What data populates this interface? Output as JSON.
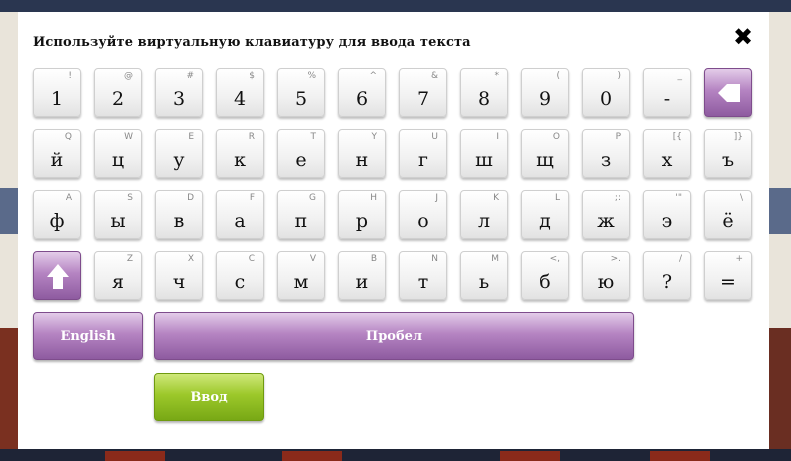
{
  "dialog": {
    "title": "Используйте виртуальную клавиатуру для ввода текста",
    "close_icon": "close-icon"
  },
  "keyboard": {
    "rows": [
      [
        {
          "primary": "1",
          "secondary": "!"
        },
        {
          "primary": "2",
          "secondary": "@"
        },
        {
          "primary": "3",
          "secondary": "#"
        },
        {
          "primary": "4",
          "secondary": "$"
        },
        {
          "primary": "5",
          "secondary": "%"
        },
        {
          "primary": "6",
          "secondary": "^"
        },
        {
          "primary": "7",
          "secondary": "&"
        },
        {
          "primary": "8",
          "secondary": "*"
        },
        {
          "primary": "9",
          "secondary": "("
        },
        {
          "primary": "0",
          "secondary": ")"
        },
        {
          "primary": "-",
          "secondary": "_"
        }
      ],
      [
        {
          "primary": "й",
          "secondary": "Q"
        },
        {
          "primary": "ц",
          "secondary": "W"
        },
        {
          "primary": "у",
          "secondary": "E"
        },
        {
          "primary": "к",
          "secondary": "R"
        },
        {
          "primary": "е",
          "secondary": "T"
        },
        {
          "primary": "н",
          "secondary": "Y"
        },
        {
          "primary": "г",
          "secondary": "U"
        },
        {
          "primary": "ш",
          "secondary": "I"
        },
        {
          "primary": "щ",
          "secondary": "O"
        },
        {
          "primary": "з",
          "secondary": "P"
        },
        {
          "primary": "х",
          "secondary": "[{"
        },
        {
          "primary": "ъ",
          "secondary": "]}"
        }
      ],
      [
        {
          "primary": "ф",
          "secondary": "A"
        },
        {
          "primary": "ы",
          "secondary": "S"
        },
        {
          "primary": "в",
          "secondary": "D"
        },
        {
          "primary": "а",
          "secondary": "F"
        },
        {
          "primary": "п",
          "secondary": "G"
        },
        {
          "primary": "р",
          "secondary": "H"
        },
        {
          "primary": "о",
          "secondary": "J"
        },
        {
          "primary": "л",
          "secondary": "K"
        },
        {
          "primary": "д",
          "secondary": "L"
        },
        {
          "primary": "ж",
          "secondary": ";:"
        },
        {
          "primary": "э",
          "secondary": "'\""
        },
        {
          "primary": "ё",
          "secondary": "\\"
        }
      ],
      [
        {
          "primary": "я",
          "secondary": "Z"
        },
        {
          "primary": "ч",
          "secondary": "X"
        },
        {
          "primary": "с",
          "secondary": "C"
        },
        {
          "primary": "м",
          "secondary": "V"
        },
        {
          "primary": "и",
          "secondary": "B"
        },
        {
          "primary": "т",
          "secondary": "N"
        },
        {
          "primary": "ь",
          "secondary": "M"
        },
        {
          "primary": "б",
          "secondary": "<,"
        },
        {
          "primary": "ю",
          "secondary": ">."
        },
        {
          "primary": "?",
          "secondary": "/"
        },
        {
          "primary": "=",
          "secondary": "+"
        }
      ]
    ],
    "backspace_icon": "backspace-icon",
    "shift_icon": "shift-arrow-icon",
    "english_label": "English",
    "space_label": "Пробел",
    "enter_label": "Ввод"
  },
  "colors": {
    "accent_purple": "#a574b4",
    "enter_green": "#8fbd22"
  }
}
